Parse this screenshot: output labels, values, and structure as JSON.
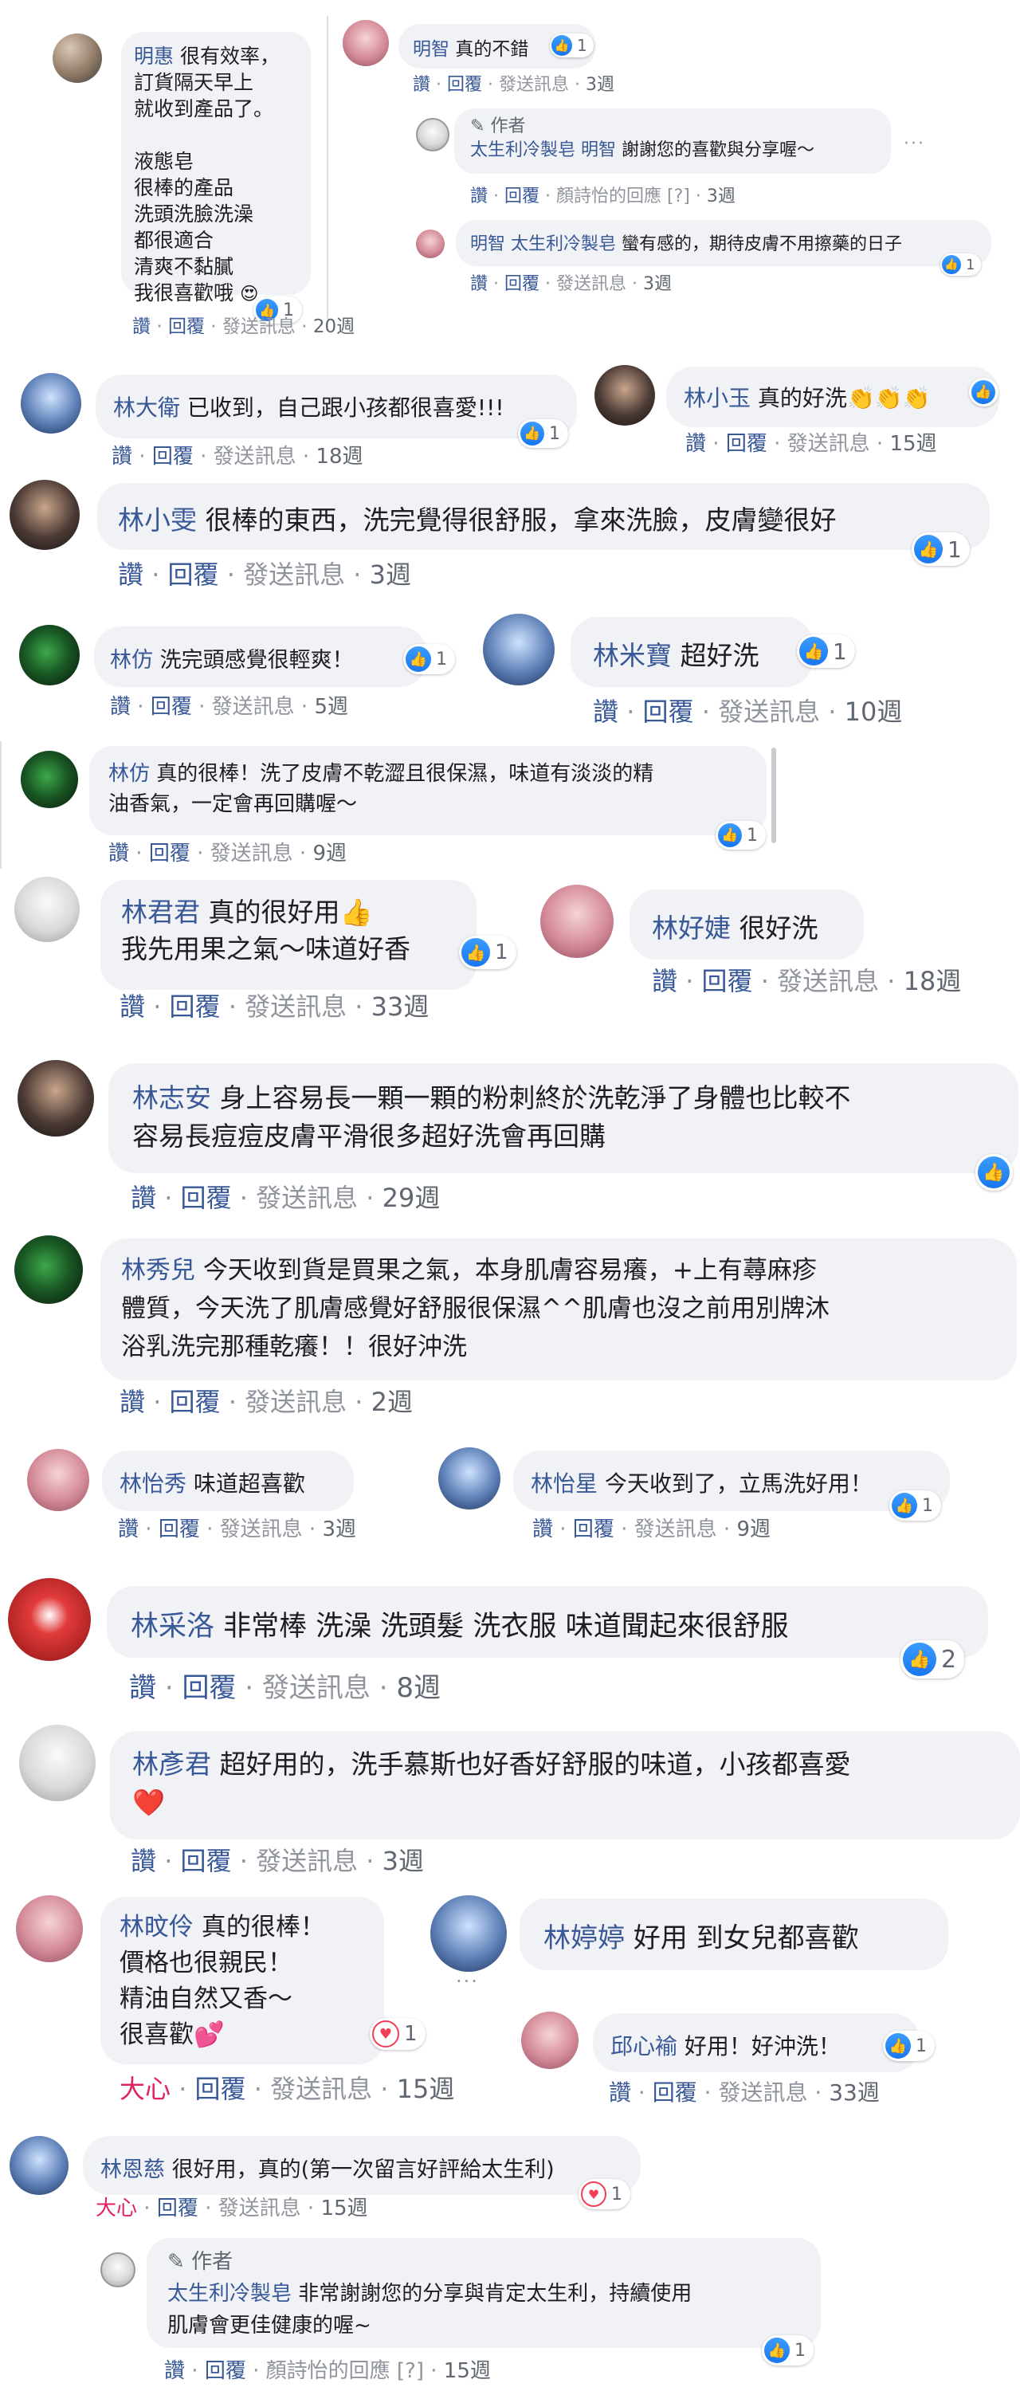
{
  "common": {
    "like": "讚",
    "reply": "回覆",
    "message": "發送訊息",
    "dot": "·",
    "author": "作者",
    "love": "大心",
    "reply_by": "顏詩怡的回應",
    "reply_by_tag": "[?]"
  },
  "c1": {
    "name": "明惠",
    "text1": "很有效率，\n訂貨隔天早上\n就收到產品了。",
    "text2": "液態皂\n很棒的產品\n洗頭洗臉洗澡\n都很適合\n清爽不黏膩\n我很喜歡哦",
    "emoji": "😍",
    "likes": "1",
    "time": "20週"
  },
  "c1r1": {
    "name": "明智",
    "text": "真的不錯",
    "likes": "1",
    "time": "3週"
  },
  "c1r2": {
    "page": "太生利冷製皂",
    "tag": "明智",
    "text": "謝謝您的喜歡與分享喔～",
    "time": "3週"
  },
  "c1r3": {
    "name": "明智",
    "tag": "太生利冷製皂",
    "text": "蠻有感的，期待皮膚不用擦藥的日子",
    "likes": "1",
    "time": "3週"
  },
  "c2": {
    "name": "林大衛",
    "text": "已收到，自己跟小孩都很喜愛!!!",
    "likes": "1",
    "time": "18週"
  },
  "c3": {
    "name": "林小玉",
    "text": "真的好洗",
    "emoji": "👏👏👏",
    "likes": "1",
    "time": "15週"
  },
  "c4": {
    "name": "林小雯",
    "text": "很棒的東西，洗完覺得很舒服，拿來洗臉，皮膚變很好",
    "likes": "1",
    "time": "3週"
  },
  "c5": {
    "name": "林仿",
    "text": "洗完頭感覺很輕爽！",
    "likes": "1",
    "time": "5週"
  },
  "c6": {
    "name": "林米寶",
    "text": "超好洗",
    "likes": "1",
    "time": "10週"
  },
  "c7": {
    "name": "林仿",
    "text": "真的很棒！洗了皮膚不乾澀且很保濕，味道有淡淡的精\n油香氣，一定會再回購喔～",
    "likes": "1",
    "time": "9週"
  },
  "c8": {
    "name": "林君君",
    "text": "真的很好用",
    "emoji": "👍",
    "text2": "我先用果之氣～味道好香",
    "likes": "1",
    "time": "33週"
  },
  "c9": {
    "name": "林好婕",
    "text": "很好洗",
    "time": "18週"
  },
  "c10": {
    "name": "林志安",
    "text": "身上容易長一顆一顆的粉刺終於洗乾淨了身體也比較不\n容易長痘痘皮膚平滑很多超好洗會再回購",
    "time": "29週"
  },
  "c11": {
    "name": "林秀兒",
    "text": "今天收到貨是買果之氣，本身肌膚容易癢，+上有蕁麻疹\n體質，今天洗了肌膚感覺好舒服很保濕^^肌膚也沒之前用別牌沐\n浴乳洗完那種乾癢！！很好沖洗",
    "time": "2週"
  },
  "c12": {
    "name": "林怡秀",
    "text": "味道超喜歡",
    "time": "3週"
  },
  "c13": {
    "name": "林怡星",
    "text": "今天收到了，立馬洗好用！",
    "likes": "1",
    "time": "9週"
  },
  "c14": {
    "name": "林采洛",
    "text": "非常棒 洗澡 洗頭髮 洗衣服 味道聞起來很舒服",
    "likes": "2",
    "time": "8週"
  },
  "c15": {
    "name": "林彥君",
    "text": "超好用的，洗手慕斯也好香好舒服的味道，小孩都喜愛",
    "emoji": "❤️",
    "time": "3週"
  },
  "c16": {
    "name": "林旼伶",
    "text": "真的很棒！\n價格也很親民！\n精油自然又香～\n很喜歡",
    "emoji": "💕",
    "likes": "1",
    "time": "15週"
  },
  "c17": {
    "name": "林婷婷",
    "text": "好用 到女兒都喜歡"
  },
  "c18": {
    "name": "邱心褕",
    "text": "好用！好沖洗！",
    "likes": "1",
    "time": "33週"
  },
  "c19": {
    "name": "林恩慈",
    "text": "很好用，真的(第一次留言好評給太生利)",
    "likes": "1",
    "time": "15週"
  },
  "c19r1": {
    "page": "太生利冷製皂",
    "text": "非常謝謝您的分享與肯定太生利，持續使用\n肌膚會更佳健康的喔~",
    "likes": "1",
    "time": "15週"
  }
}
